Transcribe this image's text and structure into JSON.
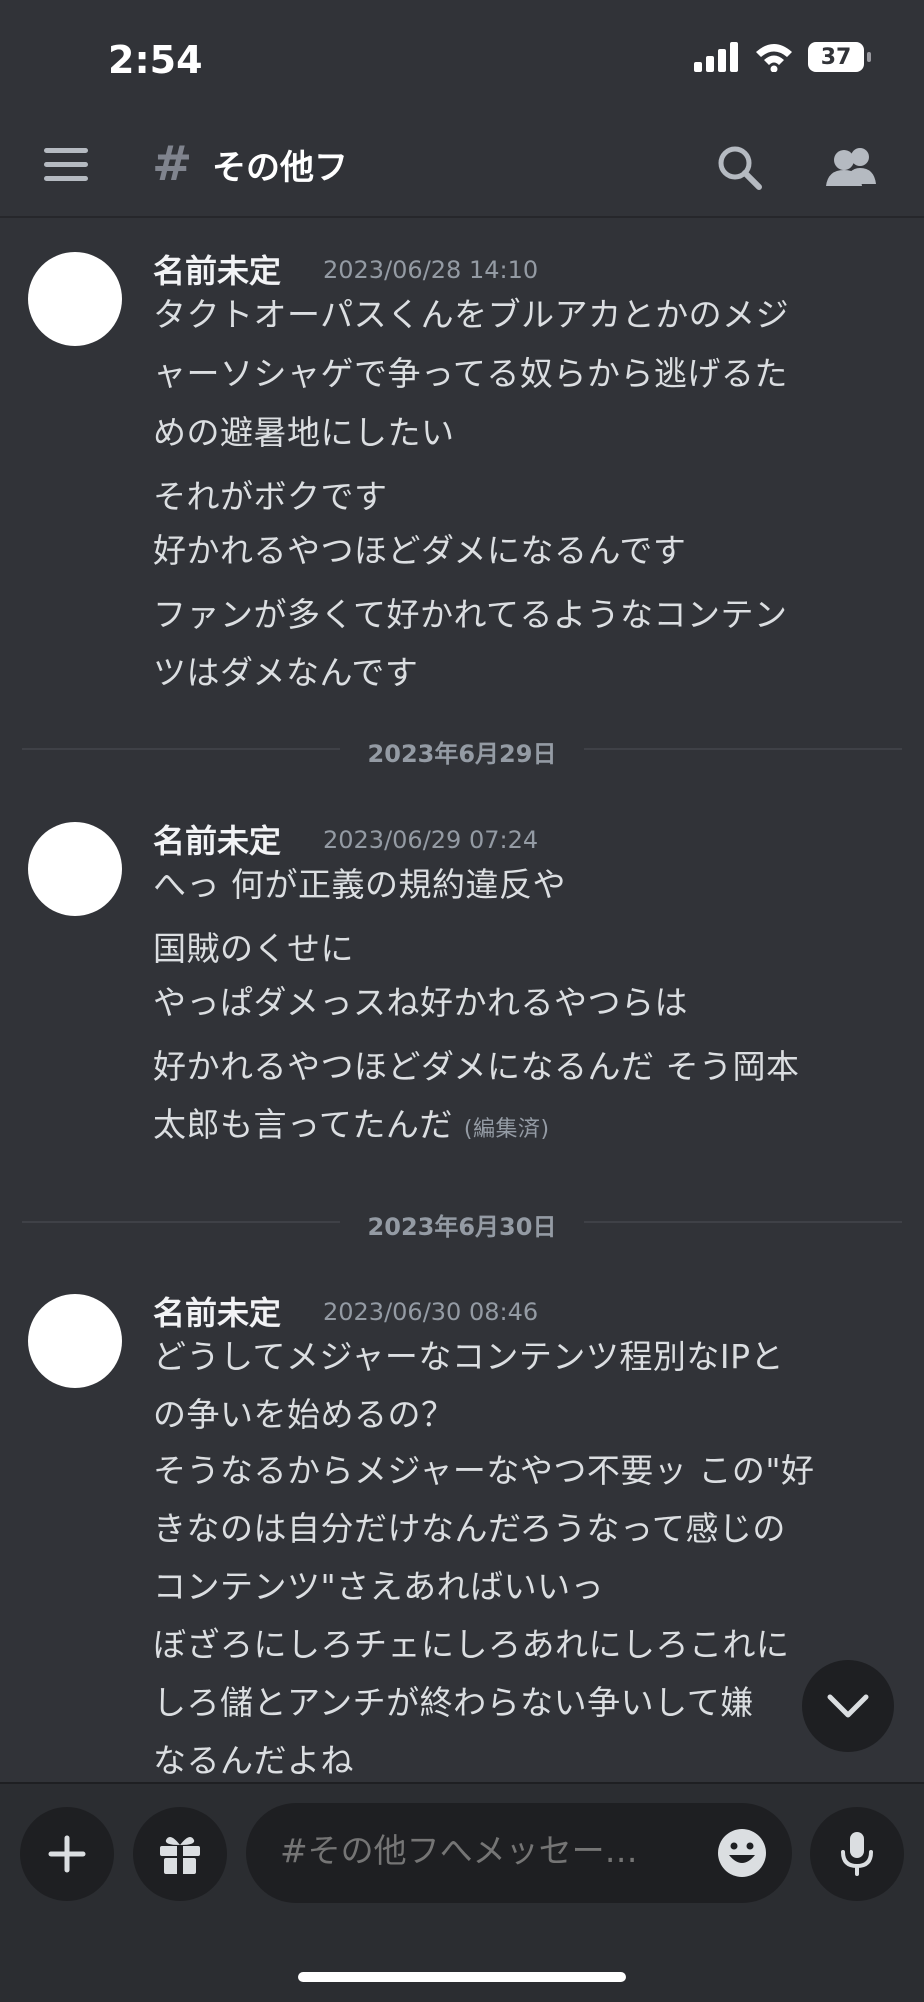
{
  "status_bar": {
    "time": "2:54",
    "battery": "37"
  },
  "header": {
    "channel_name": "その他フ"
  },
  "messages": [
    {
      "username": "名前未定",
      "timestamp": "2023/06/28 14:10",
      "lines": [
        "タクトオーパスくんをブルアカとかのメジ",
        "ャーソシャゲで争ってる奴らから逃げるた",
        "めの避暑地にしたい",
        "それがボクです",
        "好かれるやつほどダメになるんです",
        "ファンが多くて好かれてるようなコンテン",
        "ツはダメなんです"
      ]
    },
    {
      "username": "名前未定",
      "timestamp": "2023/06/29 07:24",
      "lines": [
        "へっ 何が正義の規約違反や",
        "国賊のくせに",
        "やっぱダメっスね好かれるやつらは",
        "好かれるやつほどダメになるんだ そう岡本",
        "太郎も言ってたんだ"
      ],
      "edited": "(編集済)"
    },
    {
      "username": "名前未定",
      "timestamp": "2023/06/30 08:46",
      "lines": [
        "どうしてメジャーなコンテンツ程別なIPと",
        "の争いを始めるの？",
        "そうなるからメジャーなやつ不要ッ この\"好",
        "きなのは自分だけなんだろうなって感じの",
        "コンテンツ\"さえあればいいっ",
        "ぼざろにしろチェにしろあれにしろこれに",
        "しろ儲とアンチが終わらない争いして嫌",
        "なるんだよね"
      ]
    }
  ],
  "date_dividers": [
    "2023年6月29日",
    "2023年6月30日"
  ],
  "composer": {
    "placeholder": "#その他フへメッセー…"
  },
  "icons": {
    "menu": "hamburger-menu-icon",
    "hash": "hash-icon",
    "search": "search-icon",
    "members": "members-icon",
    "add": "plus-icon",
    "gift": "gift-icon",
    "emoji": "emoji-icon",
    "mic": "microphone-icon",
    "jump": "chevron-down-icon"
  },
  "colors": {
    "background": "#313338",
    "composer_bg": "#2b2d31",
    "input_bg": "#1e1f22",
    "avatar": "#ffffff"
  }
}
